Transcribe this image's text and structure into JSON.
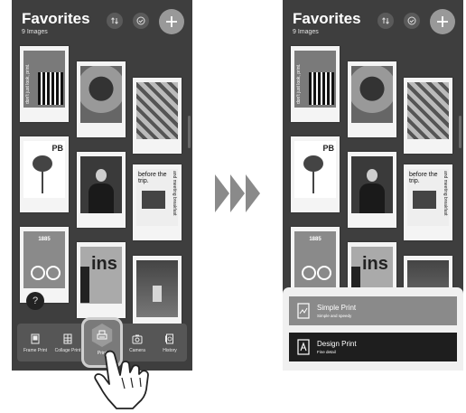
{
  "header": {
    "title": "Favorites",
    "subtitle": "9 Images"
  },
  "icons": {
    "sort": "sort-icon",
    "select": "check-circle-icon",
    "add": "plus-icon"
  },
  "photos": [
    {
      "name": "poster-text",
      "text": "don't just look, print."
    },
    {
      "name": "plant"
    },
    {
      "name": "typography-poster"
    },
    {
      "name": "flamingo",
      "text": "PB"
    },
    {
      "name": "portrait"
    },
    {
      "name": "magazine",
      "text": "before the trip.",
      "side_text": "and meeting breakfast"
    },
    {
      "name": "bicycle-poster",
      "text": "1885"
    },
    {
      "name": "ins-poster",
      "text": "ins"
    },
    {
      "name": "chair"
    }
  ],
  "help": "?",
  "tabs": [
    {
      "name": "frame-print",
      "label": "Frame Print"
    },
    {
      "name": "collage-print",
      "label": "Collage Print"
    },
    {
      "name": "print",
      "label": "Print"
    },
    {
      "name": "camera",
      "label": "Camera"
    },
    {
      "name": "history",
      "label": "History"
    }
  ],
  "print_sheet": {
    "options": [
      {
        "title": "Simple Print",
        "subtitle": "Simple and speedy"
      },
      {
        "title": "Design Print",
        "subtitle": "Fine detail"
      }
    ]
  },
  "colors": {
    "background": "#3e3e3e",
    "card": "#f4f4f4",
    "tabbar": "#565656",
    "sheet": "#f0f0f0",
    "option_simple": "#8a8a8a",
    "option_design": "#1e1e1e"
  }
}
